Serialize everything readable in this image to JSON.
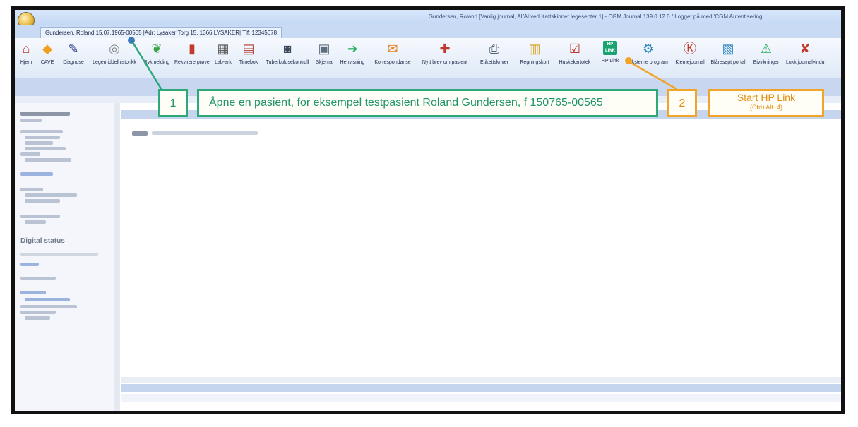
{
  "window": {
    "title": "Gundersen, Roland [Vanlig journal, Al/Al ved Kattskinnet legesenter 1] - CGM Journal 139.0.12.0 / Logget på med 'CGM Autentisering'",
    "patient_tab": "Gundersen, Roland  15.07.1965-00565   |Adr: Lysaker Torg 15, 1366 LYSAKER| Tlf: 12345678"
  },
  "ribbon": [
    {
      "label": "Hjem",
      "icon": "home-icon",
      "glyph": "⌂",
      "color": "#c0392b"
    },
    {
      "label": "CAVE",
      "icon": "warning-icon",
      "glyph": "◆",
      "color": "#f0a020"
    },
    {
      "label": "Diagnose",
      "icon": "pen-icon",
      "glyph": "✎",
      "color": "#2f3f8f"
    },
    {
      "label": "Legemiddelhistorikk",
      "icon": "pill-icon",
      "glyph": "◎",
      "color": "#7f8c8d"
    },
    {
      "label": "Sykmelding",
      "icon": "sick-note-icon",
      "glyph": "❦",
      "color": "#3aa345"
    },
    {
      "label": "Rekvirere prøver",
      "icon": "test-tube-icon",
      "glyph": "▮",
      "color": "#c0392b"
    },
    {
      "label": "Lab-ark",
      "icon": "lab-sheet-icon",
      "glyph": "▦",
      "color": "#555555"
    },
    {
      "label": "Timebok",
      "icon": "calendar-icon",
      "glyph": "▤",
      "color": "#b03a2e"
    },
    {
      "label": "Tuberkulosekontroll",
      "icon": "lungs-icon",
      "glyph": "◙",
      "color": "#3c4a5c"
    },
    {
      "label": "Skjema",
      "icon": "form-icon",
      "glyph": "▣",
      "color": "#5d6d7e"
    },
    {
      "label": "Henvisning",
      "icon": "referral-icon",
      "glyph": "➜",
      "color": "#27ae60"
    },
    {
      "label": "Korrespondanse",
      "icon": "envelope-icon",
      "glyph": "✉",
      "color": "#e67e22"
    },
    {
      "label": "Nytt brev om pasient",
      "icon": "new-letter-icon",
      "glyph": "✚",
      "color": "#c0392b"
    },
    {
      "label": "Etikettskriver",
      "icon": "printer-icon",
      "glyph": "⎙",
      "color": "#566573"
    },
    {
      "label": "Regningskort",
      "icon": "bill-card-icon",
      "glyph": "▥",
      "color": "#d4a017"
    },
    {
      "label": "Huskekartotek",
      "icon": "checklist-icon",
      "glyph": "☑",
      "color": "#c0392b"
    },
    {
      "label": "HP Link",
      "icon": "hp-link-icon",
      "glyph": "HP",
      "color": "#1aa371"
    },
    {
      "label": "Eksterne program",
      "icon": "external-program-icon",
      "glyph": "⚙",
      "color": "#2e86c1"
    },
    {
      "label": "Kjernejournal",
      "icon": "kj-icon",
      "glyph": "Ⓚ",
      "color": "#c0392b"
    },
    {
      "label": "Blåresept portal",
      "icon": "prescription-icon",
      "glyph": "▧",
      "color": "#2e86c1"
    },
    {
      "label": "Bivirkninger",
      "icon": "side-effects-icon",
      "glyph": "⚠",
      "color": "#27ae60"
    },
    {
      "label": "Lukk journalvindu",
      "icon": "close-icon",
      "glyph": "✘",
      "color": "#c0392b"
    }
  ],
  "sidebar": {
    "section_title": "Digital status"
  },
  "callouts": {
    "step1": {
      "number": "1",
      "text": "Åpne en pasient, for eksempel testpasient Roland Gundersen, f 150765-00565"
    },
    "step2": {
      "number": "2",
      "title": "Start HP Link",
      "shortcut": "(Ctrl+Alt+4)"
    }
  }
}
